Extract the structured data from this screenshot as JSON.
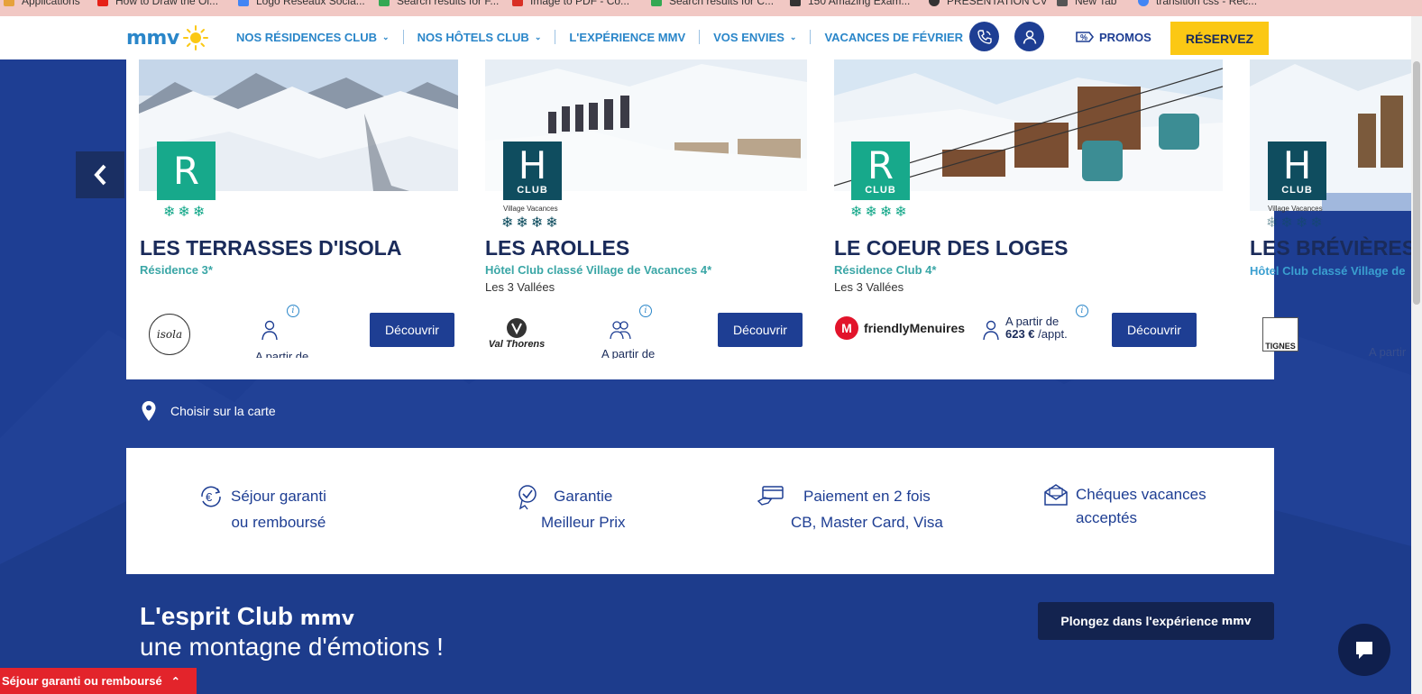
{
  "bookmarks": [
    {
      "label": "Applications",
      "color": "#e6a23c"
    },
    {
      "label": "How to Draw the Ol...",
      "color": "#e62117"
    },
    {
      "label": "Logo Réseaux Socia...",
      "color": "#4285f4"
    },
    {
      "label": "Search results for F...",
      "color": "#34a853"
    },
    {
      "label": "Image to PDF - Co...",
      "color": "#d93025"
    },
    {
      "label": "Search results for C...",
      "color": "#34a853"
    },
    {
      "label": "150 Amazing Exam...",
      "color": "#333333"
    },
    {
      "label": "PRÉSENTATION CV",
      "color": "#333333"
    },
    {
      "label": "New Tab",
      "color": "#555555"
    },
    {
      "label": "transition css - Rec...",
      "color": "#4285f4"
    }
  ],
  "header": {
    "logo_text": "mmv",
    "nav": [
      {
        "label": "NOS RÉSIDENCES CLUB",
        "dropdown": true
      },
      {
        "label": "NOS HÔTELS CLUB",
        "dropdown": true
      },
      {
        "label": "L'EXPÉRIENCE MMV",
        "dropdown": false
      },
      {
        "label": "VOS ENVIES",
        "dropdown": true
      },
      {
        "label": "VACANCES DE FÉVRIER",
        "dropdown": false
      }
    ],
    "promos_label": "PROMOS",
    "reserve_label": "RÉSERVEZ"
  },
  "cards": [
    {
      "badge_letter": "R",
      "badge_club": "",
      "village_label": "",
      "stars": "❄❄❄",
      "title": "LES TERRASSES D'ISOLA",
      "subtitle": "Résidence 3*",
      "area": "",
      "partner": "isola",
      "price_label": "A partir de",
      "price": "",
      "cta": "Découvrir"
    },
    {
      "badge_letter": "H",
      "badge_club": "CLUB",
      "village_label": "Village Vacances",
      "stars": "❄❄❄❄",
      "title": "LES AROLLES",
      "subtitle": "Hôtel Club classé Village de Vacances 4*",
      "area": "Les 3 Vallées",
      "partner": "Val Thorens",
      "price_label": "A partir de",
      "price": "",
      "cta": "Découvrir"
    },
    {
      "badge_letter": "R",
      "badge_club": "CLUB",
      "village_label": "",
      "stars": "❄❄❄❄",
      "title": "LE COEUR DES LOGES",
      "subtitle": "Résidence Club 4*",
      "area": "Les 3 Vallées",
      "partner": "friendlyMenuires",
      "price_label": "A partir de",
      "price": "623 €",
      "unit": "/appt.",
      "cta": "Découvrir"
    },
    {
      "badge_letter": "H",
      "badge_club": "CLUB",
      "village_label": "Village Vacances",
      "stars": "❄❄❄❄",
      "title": "LES BRÉVIÈRES",
      "subtitle": "Hôtel Club classé Village de",
      "area": "",
      "partner": "TIGNES",
      "price_label": "A partir",
      "price": "",
      "cta": ""
    }
  ],
  "info_mark": "i",
  "map_link": "Choisir sur la carte",
  "guarantees": [
    {
      "line1": "Séjour garanti",
      "line2": "ou remboursé",
      "icon": "euro-refresh-icon"
    },
    {
      "line1": "Garantie",
      "line2": "Meilleur Prix",
      "icon": "award-badge-icon"
    },
    {
      "line1": "Paiement en 2 fois",
      "line2": "CB, Master Card, Visa",
      "icon": "card-payment-icon"
    },
    {
      "line1": "Chéques vacances",
      "line2": "acceptés",
      "icon": "envelope-icon"
    }
  ],
  "esprit": {
    "line1": "L'esprit Club",
    "brand": "mmv",
    "line2": "une montagne d'émotions !"
  },
  "plongez": {
    "label": "Plongez dans l'expérience",
    "brand": "mmv"
  },
  "sticky_label": "Séjour garanti ou remboursé",
  "colors": {
    "navy": "#1e3e93",
    "accent_yellow": "#fbc814",
    "green_badge": "#17a98b",
    "teal_badge": "#0f4d5f",
    "sticky_red": "#e3242b"
  }
}
